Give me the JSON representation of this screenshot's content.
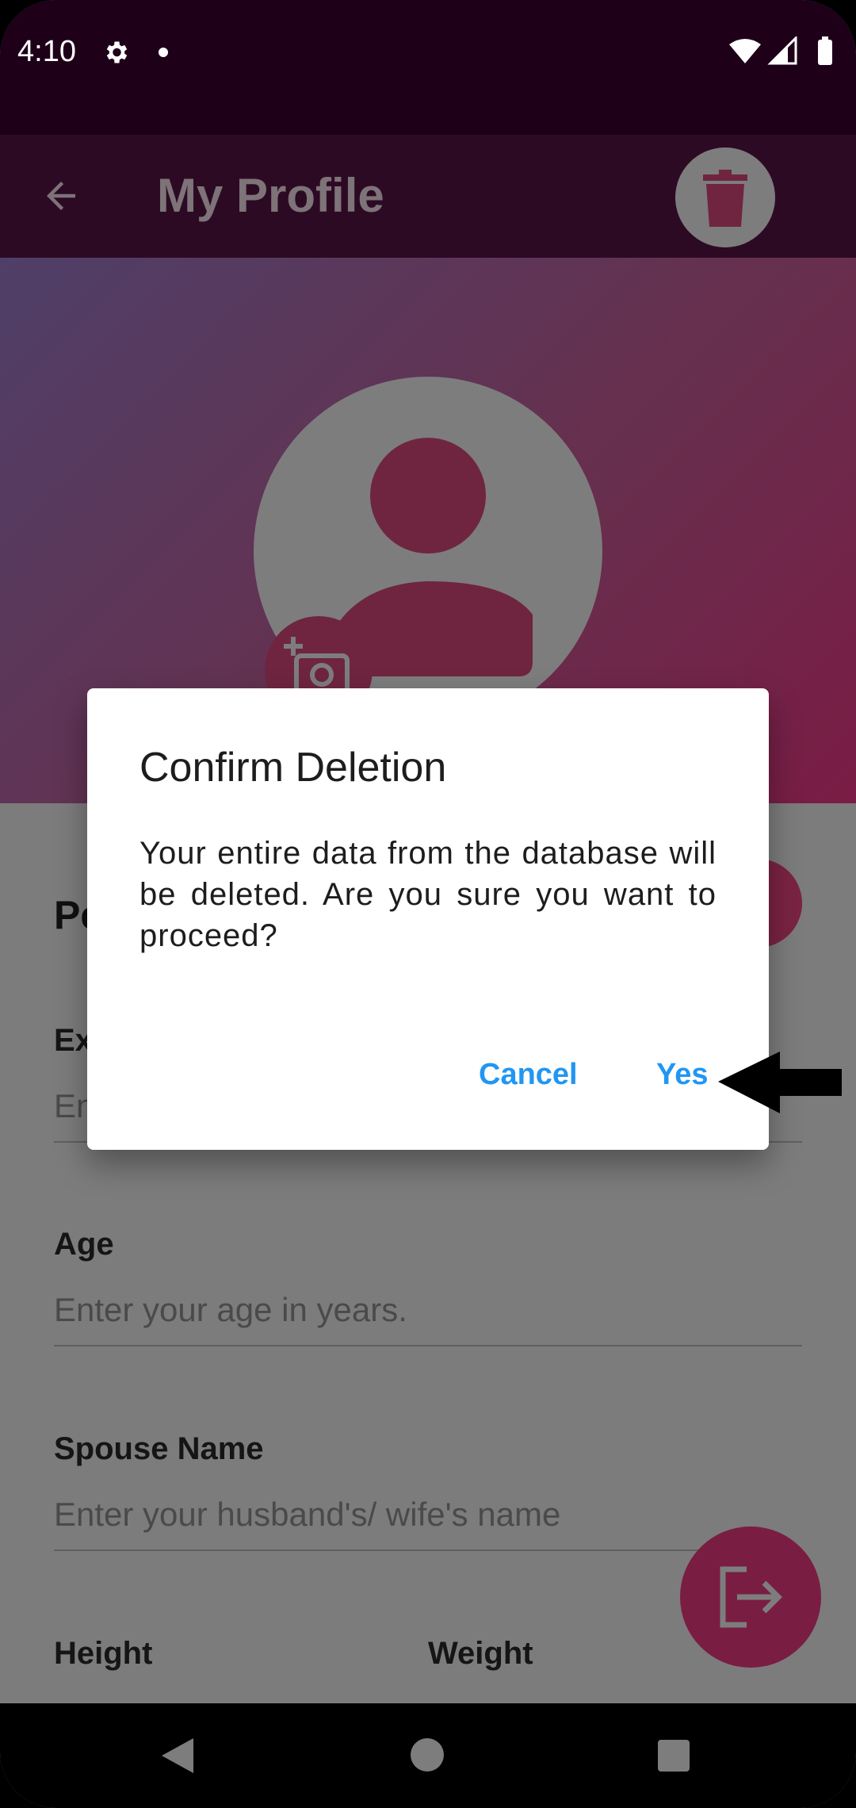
{
  "status_bar": {
    "time": "4:10"
  },
  "app_bar": {
    "title": "My Profile"
  },
  "form": {
    "section_title": "Pe",
    "fields": [
      {
        "label": "Ex",
        "placeholder": "En"
      },
      {
        "label": "Age",
        "placeholder": "Enter your age in years."
      },
      {
        "label": "Spouse Name",
        "placeholder": "Enter your husband's/ wife's name"
      }
    ],
    "height_label": "Height",
    "weight_label": "Weight"
  },
  "dialog": {
    "title": "Confirm Deletion",
    "message": "Your entire data from the database will be deleted. Are you sure you want to proceed?",
    "cancel_label": "Cancel",
    "yes_label": "Yes"
  },
  "colors": {
    "accent_link": "#2196f3",
    "brand": "#7a1c45",
    "status_bar": "#1e0019"
  },
  "icons": [
    "settings-gear-icon",
    "wifi-icon",
    "signal-icon",
    "battery-icon",
    "back-arrow-icon",
    "trash-icon",
    "person-icon",
    "add-photo-icon",
    "logout-icon",
    "nav-back-icon",
    "nav-home-icon",
    "nav-recents-icon"
  ]
}
